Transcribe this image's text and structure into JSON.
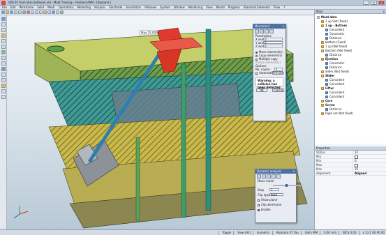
{
  "window": {
    "title": "VISI 20 from Vero Software.vld - Mold Training - Finished.ASM - [Dynamic]",
    "controls": [
      "_",
      "□",
      "x"
    ]
  },
  "menu": [
    "File",
    "Edit",
    "Wireframe",
    "Solid",
    "Mesh",
    "Operations",
    "Modelling",
    "Analysis",
    "Electrode",
    "Annotation",
    "Plotview",
    "System",
    "Window",
    "Machining",
    "View",
    "Mould",
    "Progress",
    "Standard Elements",
    "Flow",
    "?"
  ],
  "viewport": {
    "annotation_label": "Max 25.0000",
    "colors": {
      "red": "#e03a2e",
      "green": "#7fbf4a",
      "teal": "#3aa3a0",
      "yellow": "#d9c94a",
      "grey": "#8a8f95"
    }
  },
  "move_dialog": {
    "title": "Movement",
    "section": "Parameters",
    "fields": [
      {
        "label": "X axis",
        "value": "0"
      },
      {
        "label": "Y axis",
        "value": "0"
      },
      {
        "label": "Z axis",
        "value": "0"
      }
    ],
    "mode_options": [
      "Move element(s)",
      "Copy element(s)",
      "Multiple copy"
    ],
    "selected_mode": "Move element(s)",
    "rotate_label": "Rotate element(s)",
    "options_label": "Options",
    "copies_label": "No. copies",
    "copies_value": "1",
    "automatic_label": "Automatic",
    "preview_label": "Preview",
    "warning": "Warning: a collision has been detected",
    "ok": "OK",
    "cancel": "Cancel"
  },
  "dynamic_dialog": {
    "title": "Dynamic analysis",
    "move_label": "Move mode",
    "step_label": "Step",
    "step_value": "1",
    "clip_label": "Clip type",
    "clip_value": "Both",
    "show_plane": "Show plane",
    "clip_wireframe": "Clip wireframe",
    "enable": "Enable"
  },
  "panel": {
    "title": "Main",
    "tree": [
      {
        "label": "Mold data",
        "bold": true,
        "icon": "g",
        "indent": 0
      },
      {
        "label": "1 up Slot (fixed)",
        "icon": "y",
        "indent": 1
      },
      {
        "label": "1 up - Bottom",
        "bold": true,
        "icon": "y",
        "indent": 1
      },
      {
        "label": "Coincident",
        "icon": "b",
        "indent": 2
      },
      {
        "label": "Concentric",
        "icon": "b",
        "indent": 2
      },
      {
        "label": "Distance",
        "icon": "b",
        "indent": 2
      },
      {
        "label": "Bottom (Fixed)",
        "icon": "y",
        "indent": 1
      },
      {
        "label": "1 up (Not fixed)",
        "icon": "y",
        "indent": 1
      },
      {
        "label": "Ejection (Not fixed)",
        "icon": "y",
        "indent": 1
      },
      {
        "label": "Distance",
        "icon": "b",
        "indent": 2
      },
      {
        "label": "Ejection",
        "bold": true,
        "icon": "y",
        "indent": 1
      },
      {
        "label": "Concentric",
        "icon": "b",
        "indent": 2
      },
      {
        "label": "Distance",
        "icon": "b",
        "indent": 2
      },
      {
        "label": "Slider (Not fixed)",
        "icon": "y",
        "indent": 1
      },
      {
        "label": "Slider",
        "bold": true,
        "icon": "y",
        "indent": 1
      },
      {
        "label": "Coincident",
        "icon": "b",
        "indent": 2
      },
      {
        "label": "Coincident",
        "icon": "b",
        "indent": 2
      },
      {
        "label": "Lifter",
        "bold": true,
        "icon": "y",
        "indent": 1
      },
      {
        "label": "Coincident",
        "icon": "b",
        "indent": 2
      },
      {
        "label": "Coincident",
        "icon": "b",
        "indent": 2
      },
      {
        "label": "Core",
        "bold": true,
        "icon": "y",
        "indent": 1
      },
      {
        "label": "Screw",
        "bold": true,
        "icon": "y",
        "indent": 1
      },
      {
        "label": "Distance",
        "icon": "b",
        "indent": 2
      },
      {
        "label": "Rigid set (Not fixed)",
        "icon": "y",
        "indent": 1
      }
    ]
  },
  "properties": {
    "title": "Properties",
    "rows": [
      {
        "key": "Status",
        "value": "12"
      },
      {
        "key": "Min",
        "value": "",
        "check": true
      },
      {
        "key": "Min",
        "value": "0"
      },
      {
        "key": "Max",
        "value": "",
        "check": true
      },
      {
        "key": "Max",
        "value": "25"
      },
      {
        "key": "Alignment",
        "value": "Aligned",
        "bold": true
      }
    ]
  },
  "status": {
    "items": [
      "Toggle",
      "View (All)",
      "Isometric",
      "Absolute XY Top",
      "Units MM",
      "0.00 mm",
      "WCS 0.00",
      "x 13.1 00 P0.00"
    ]
  }
}
